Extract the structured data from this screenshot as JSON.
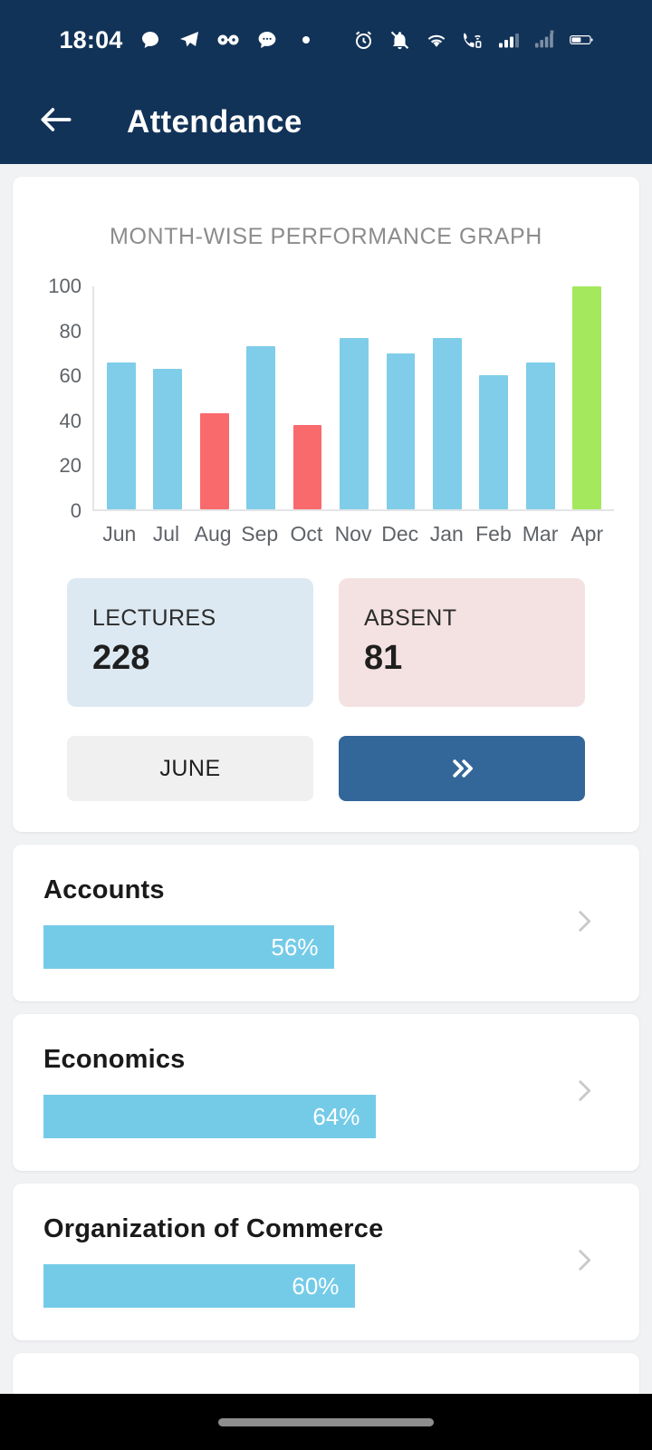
{
  "status_bar": {
    "time": "18:04",
    "left_icons": [
      "chat-bubble-icon",
      "telegram-icon",
      "glasses-icon",
      "messages-icon",
      "dot-icon"
    ],
    "right_icons": [
      "alarm-icon",
      "bell-muted-icon",
      "wifi-icon",
      "wifi-calling-icon",
      "signal-bars-icon",
      "signal-no-service-icon",
      "battery-icon"
    ]
  },
  "app_bar": {
    "back_icon": "arrow-left-icon",
    "title": "Attendance"
  },
  "chart_data": {
    "type": "bar",
    "title": "MONTH-WISE PERFORMANCE GRAPH",
    "categories": [
      "Jun",
      "Jul",
      "Aug",
      "Sep",
      "Oct",
      "Nov",
      "Dec",
      "Jan",
      "Feb",
      "Mar",
      "Apr"
    ],
    "values": [
      66,
      63,
      43,
      73,
      38,
      77,
      70,
      77,
      60,
      66,
      100
    ],
    "colors": [
      "#7fcde8",
      "#7fcde8",
      "#f96a6c",
      "#7fcde8",
      "#f96a6c",
      "#7fcde8",
      "#7fcde8",
      "#7fcde8",
      "#7fcde8",
      "#7fcde8",
      "#a4e85e"
    ],
    "xlabel": "",
    "ylabel": "",
    "ylim": [
      0,
      100
    ],
    "yticks": [
      0,
      20,
      40,
      60,
      80,
      100
    ],
    "grid": false,
    "legend": "none"
  },
  "stats": [
    {
      "label": "LECTURES",
      "value": "228",
      "theme": "blue"
    },
    {
      "label": "ABSENT",
      "value": "81",
      "theme": "pink"
    }
  ],
  "buttons": {
    "month_label": "JUNE",
    "next_label": "»",
    "next_icon": "double-chevron-right-icon",
    "next_color": "#336699"
  },
  "subjects": [
    {
      "name": "Accounts",
      "percent_label": "56%",
      "percent": 56
    },
    {
      "name": "Economics",
      "percent_label": "64%",
      "percent": 64
    },
    {
      "name": "Organization of Commerce",
      "percent_label": "60%",
      "percent": 60
    }
  ],
  "colors": {
    "header_bg": "#123358",
    "bar_blue": "#7fcde8",
    "bar_red": "#f96a6c",
    "bar_green": "#a4e85e",
    "progress": "#74cbe8",
    "page_bg": "#f1f2f4"
  }
}
